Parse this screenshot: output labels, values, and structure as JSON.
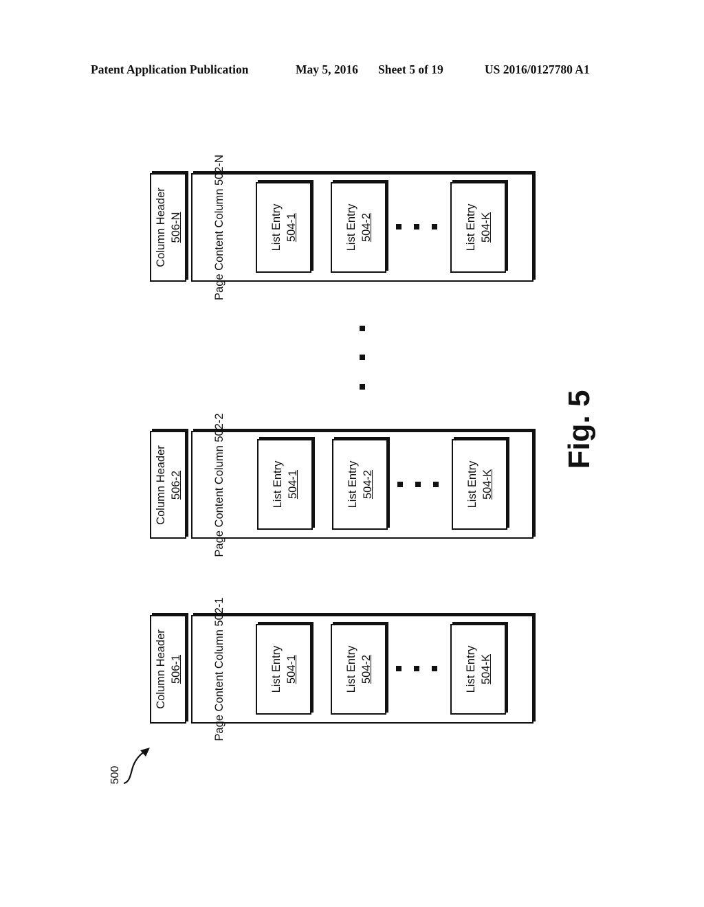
{
  "header": {
    "publication": "Patent Application Publication",
    "date": "May 5, 2016",
    "sheet": "Sheet 5 of 19",
    "number": "US 2016/0127780 A1"
  },
  "figure": {
    "label": "Fig. 5",
    "reference": "500",
    "column_groups": [
      {
        "header": {
          "title": "Column Header",
          "ref": "506-N"
        },
        "content": {
          "title_line1": "Page Content",
          "title_line2": "Column",
          "ref": "502-N"
        },
        "entries": [
          {
            "title": "List Entry",
            "ref": "504-1"
          },
          {
            "title": "List Entry",
            "ref": "504-2"
          },
          {
            "title": "List Entry",
            "ref": "504-K"
          }
        ]
      },
      {
        "header": {
          "title": "Column Header",
          "ref": "506-2"
        },
        "content": {
          "title_line1": "Page Content",
          "title_line2": "Column",
          "ref": "502-2"
        },
        "entries": [
          {
            "title": "List Entry",
            "ref": "504-1"
          },
          {
            "title": "List Entry",
            "ref": "504-2"
          },
          {
            "title": "List Entry",
            "ref": "504-K"
          }
        ]
      },
      {
        "header": {
          "title": "Column Header",
          "ref": "506-1"
        },
        "content": {
          "title_line1": "Page Content",
          "title_line2": "Column",
          "ref": "502-1"
        },
        "entries": [
          {
            "title": "List Entry",
            "ref": "504-1"
          },
          {
            "title": "List Entry",
            "ref": "504-2"
          },
          {
            "title": "List Entry",
            "ref": "504-K"
          }
        ]
      }
    ]
  }
}
